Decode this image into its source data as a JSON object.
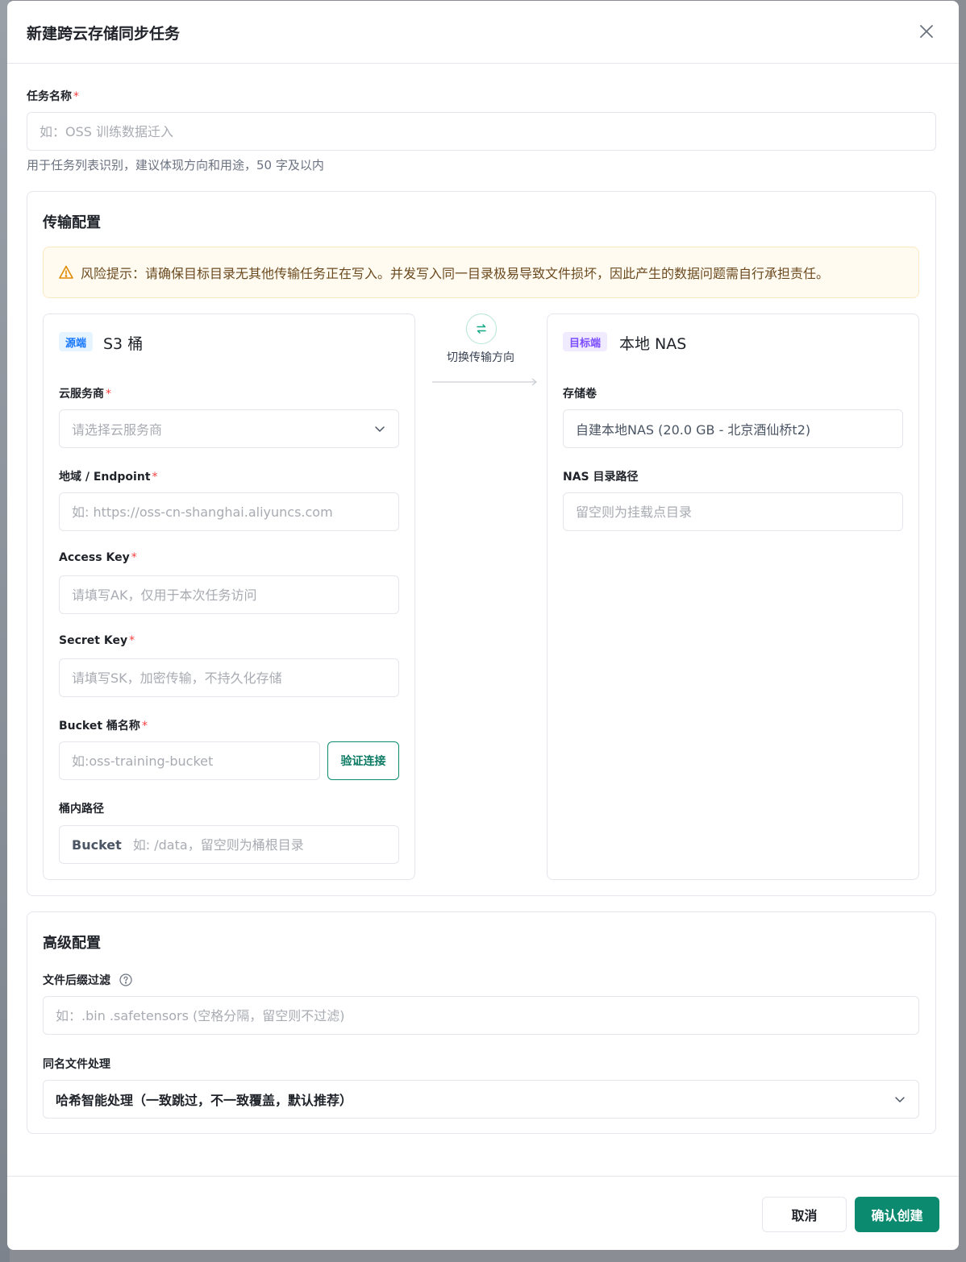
{
  "modal": {
    "title": "新建跨云存储同步任务"
  },
  "task_name": {
    "label": "任务名称",
    "required_mark": "*",
    "placeholder": "如：OSS 训练数据迁入",
    "hint": "用于任务列表识别，建议体现方向和用途，50 字及以内"
  },
  "transfer": {
    "title": "传输配置",
    "warning": "风险提示：请确保目标目录无其他传输任务正在写入。并发写入同一目录极易导致文件损坏，因此产生的数据问题需自行承担责任。",
    "swap_label": "切换传输方向",
    "source": {
      "tag": "源端",
      "title": "S3 桶",
      "provider_label": "云服务商",
      "provider_placeholder": "请选择云服务商",
      "endpoint_label": "地域 / Endpoint",
      "endpoint_placeholder": "如: https://oss-cn-shanghai.aliyuncs.com",
      "ak_label": "Access Key",
      "ak_placeholder": "请填写AK，仅用于本次任务访问",
      "sk_label": "Secret Key",
      "sk_placeholder": "请填写SK，加密传输，不持久化存储",
      "bucket_label": "Bucket 桶名称",
      "bucket_placeholder": "如:oss-training-bucket",
      "verify_button": "验证连接",
      "path_label": "桶内路径",
      "path_prefix": "Bucket",
      "path_placeholder": "如: /data，留空则为桶根目录"
    },
    "target": {
      "tag": "目标端",
      "title": "本地 NAS",
      "volume_label": "存储卷",
      "volume_value": "自建本地NAS (20.0 GB - 北京酒仙桥t2)",
      "path_label": "NAS 目录路径",
      "path_placeholder": "留空则为挂载点目录"
    }
  },
  "advanced": {
    "title": "高级配置",
    "suffix_label": "文件后缀过滤",
    "suffix_placeholder": "如：.bin .safetensors (空格分隔，留空则不过滤)",
    "dup_label": "同名文件处理",
    "dup_value": "哈希智能处理（一致跳过，不一致覆盖，默认推荐）"
  },
  "footer": {
    "cancel": "取消",
    "confirm": "确认创建"
  },
  "colors": {
    "primary": "#0b8a6f",
    "required": "#f53f3f",
    "warning_bg": "#fffbf0"
  }
}
